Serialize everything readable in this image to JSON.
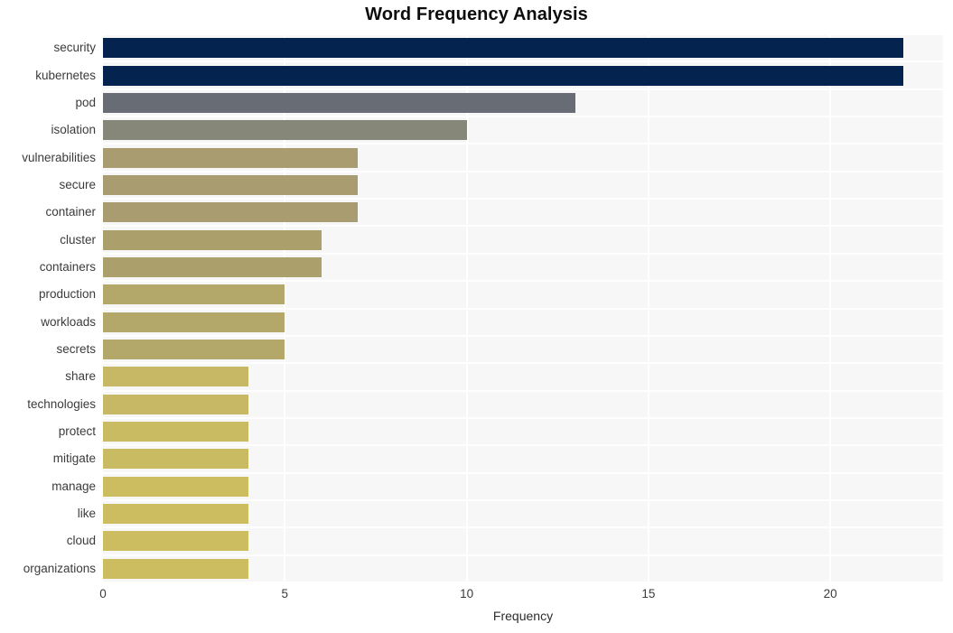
{
  "chart_data": {
    "type": "bar",
    "orientation": "horizontal",
    "title": "Word Frequency Analysis",
    "xlabel": "Frequency",
    "ylabel": "",
    "xlim": [
      0,
      23.1
    ],
    "xticks": [
      0,
      5,
      10,
      15,
      20
    ],
    "xtick_labels": [
      "0",
      "5",
      "10",
      "15",
      "20"
    ],
    "grid": true,
    "legend": false,
    "categories": [
      "security",
      "kubernetes",
      "pod",
      "isolation",
      "vulnerabilities",
      "secure",
      "container",
      "cluster",
      "containers",
      "production",
      "workloads",
      "secrets",
      "share",
      "technologies",
      "protect",
      "mitigate",
      "manage",
      "like",
      "cloud",
      "organizations"
    ],
    "values": [
      22,
      22,
      13,
      10,
      7,
      7,
      7,
      6,
      6,
      5,
      5,
      5,
      4,
      4,
      4,
      4,
      4,
      4,
      4,
      4
    ],
    "bar_colors": [
      "#04234f",
      "#04234f",
      "#686c74",
      "#878779",
      "#a89c70",
      "#a89c70",
      "#a89c70",
      "#ab9f6c",
      "#ab9f6c",
      "#b3a86a",
      "#b3a86a",
      "#b3a86a",
      "#c6b864",
      "#c6b864",
      "#c9bb62",
      "#c9bb62",
      "#ccbd61",
      "#ccbd61",
      "#ccbd61",
      "#ccbd61"
    ],
    "plot_background": "#f7f7f7",
    "grid_color": "#ffffff",
    "figure_background": "#ffffff"
  }
}
